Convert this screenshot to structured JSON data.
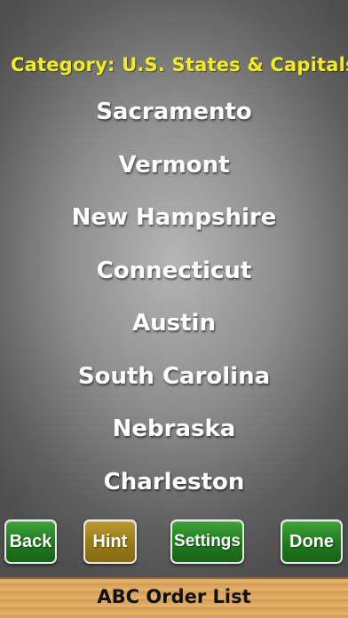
{
  "category_label": "Category: U.S. States & Capitals",
  "words": [
    "Sacramento",
    "Vermont",
    "New Hampshire",
    "Connecticut",
    "Austin",
    "South Carolina",
    "Nebraska",
    "Charleston"
  ],
  "buttons": {
    "back": "Back",
    "hint": "Hint",
    "settings": "Settings",
    "done": "Done"
  },
  "footer": {
    "title": "ABC Order List"
  },
  "colors": {
    "category_text": "#f2ee1c",
    "word_text": "#ffffff",
    "button_green": "#1f7a1d",
    "button_gold": "#987b16",
    "footer_wood": "#dfac63"
  }
}
